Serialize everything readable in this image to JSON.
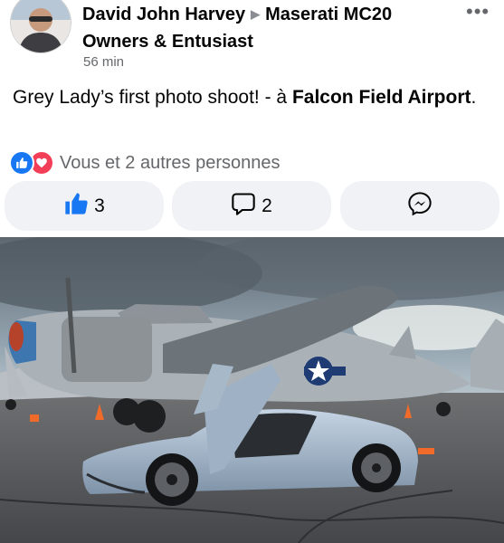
{
  "post": {
    "author": "David John Harvey",
    "group": "Maserati MC20 Owners & Entusiast",
    "time": "56 min",
    "more_icon": "more-horizontal-icon",
    "caption_prefix": "Grey Lady’s first photo shoot! - à ",
    "caption_place": "Falcon Field Airport",
    "caption_suffix": "."
  },
  "reactions": {
    "text": "Vous et 2 autres personnes",
    "icons": [
      "like-icon",
      "love-icon"
    ]
  },
  "actions": {
    "like_count": "3",
    "comment_count": "2",
    "accent": "#1877f2"
  },
  "colors": {
    "like": "#1877f2",
    "love": "#f33e58",
    "button_bg": "#f0f2f5",
    "secondary_text": "#65676b"
  }
}
